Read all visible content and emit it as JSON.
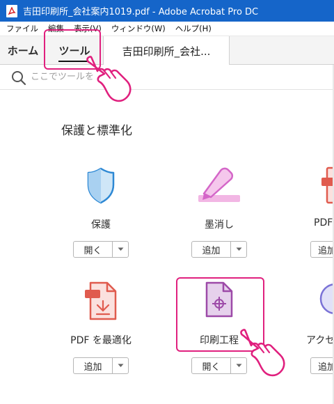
{
  "window": {
    "title": "吉田印刷所_会社案内1019.pdf - Adobe Acrobat Pro DC"
  },
  "menubar": {
    "items": [
      "ファイル",
      "編集",
      "表示(V)",
      "ウィンドウ(W)",
      "ヘルプ(H)"
    ]
  },
  "tabs": {
    "home": "ホーム",
    "tools": "ツール",
    "document": "吉田印刷所_会社..."
  },
  "search": {
    "placeholder": "ここでツールを"
  },
  "section": {
    "title": "保護と標準化"
  },
  "tools": [
    {
      "name": "保護",
      "button": "開く",
      "icon": "shield-icon"
    },
    {
      "name": "墨消し",
      "button": "追加",
      "icon": "redact-marker-icon"
    },
    {
      "name": "PDF",
      "button": "追加",
      "icon": "pdf-standards-icon"
    },
    {
      "name": "PDF を最適化",
      "button": "追加",
      "icon": "optimize-pdf-icon"
    },
    {
      "name": "印刷工程",
      "button": "開く",
      "icon": "print-production-icon"
    },
    {
      "name": "アクセシ",
      "button": "追加",
      "icon": "accessibility-icon"
    }
  ],
  "colors": {
    "titlebar": "#1565c9",
    "highlight": "#e0207e"
  }
}
